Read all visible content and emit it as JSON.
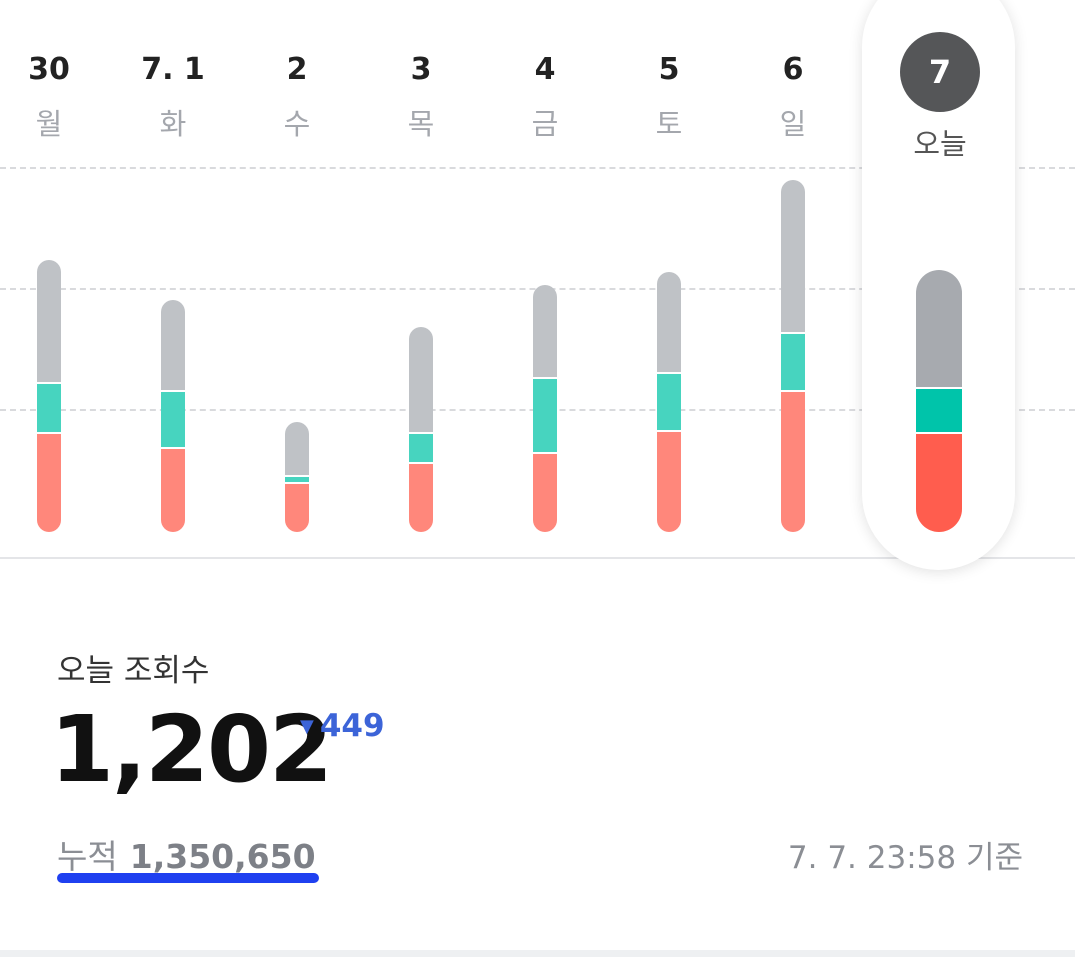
{
  "chart_data": {
    "type": "bar",
    "stacked": true,
    "categories": [
      "30",
      "7. 1",
      "2",
      "3",
      "4",
      "5",
      "6",
      "7"
    ],
    "weekdays": [
      "월",
      "화",
      "수",
      "목",
      "금",
      "토",
      "일",
      "오늘"
    ],
    "series": [
      {
        "color": "#ff877b",
        "values": [
          400,
          340,
          200,
          280,
          320,
          410,
          570,
          400
        ]
      },
      {
        "color": "#47d4bf",
        "values": [
          200,
          230,
          30,
          120,
          300,
          230,
          230,
          180
        ]
      },
      {
        "color": "#bfc2c6",
        "values": [
          490,
          360,
          210,
          420,
          370,
          400,
          610,
          470
        ]
      }
    ],
    "ylim": [
      0,
      1430
    ],
    "grid": true,
    "highlight_index": 7
  },
  "summary": {
    "title": "오늘 조회수",
    "value": "1,202",
    "change": "449",
    "change_direction": "down",
    "change_color": "#3c64d8",
    "cumulative_label": "누적",
    "cumulative_value": "1,350,650",
    "timestamp": "7. 7. 23:58 기준"
  }
}
